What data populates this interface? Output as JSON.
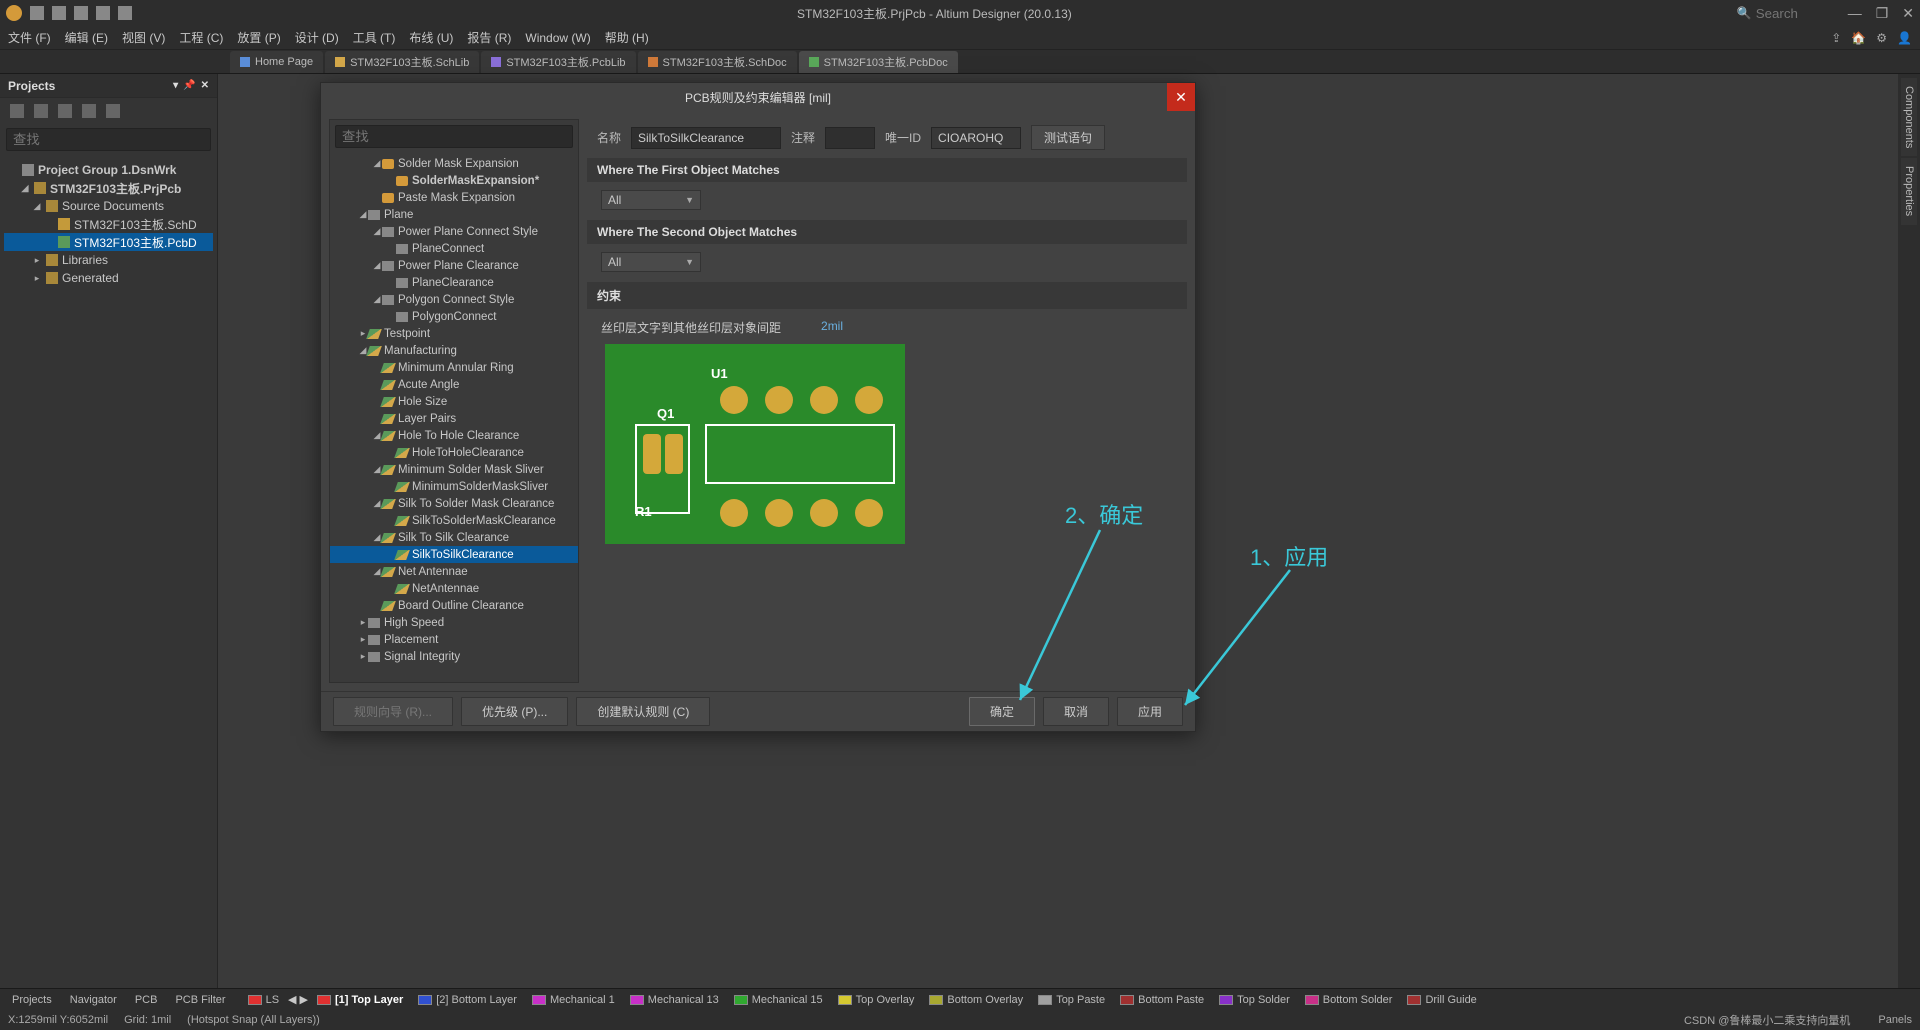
{
  "titlebar": {
    "title": "STM32F103主板.PrjPcb - Altium Designer (20.0.13)",
    "search_placeholder": "Search"
  },
  "menubar": {
    "items": [
      "文件 (F)",
      "编辑 (E)",
      "视图 (V)",
      "工程 (C)",
      "放置 (P)",
      "设计 (D)",
      "工具 (T)",
      "布线 (U)",
      "报告 (R)",
      "Window (W)",
      "帮助 (H)"
    ]
  },
  "doc_tabs": [
    {
      "label": "Home Page",
      "cls": "ico-home"
    },
    {
      "label": "STM32F103主板.SchLib",
      "cls": "ico-sch"
    },
    {
      "label": "STM32F103主板.PcbLib",
      "cls": "ico-pcblib"
    },
    {
      "label": "STM32F103主板.SchDoc",
      "cls": "ico-schdoc"
    },
    {
      "label": "STM32F103主板.PcbDoc",
      "cls": "ico-pcbdoc",
      "active": true
    }
  ],
  "projects_panel": {
    "title": "Projects",
    "search_placeholder": "查找",
    "tree": [
      {
        "ind": 0,
        "arrow": "",
        "ico": "grp",
        "label": "Project Group 1.DsnWrk",
        "bold": true,
        "sel": false
      },
      {
        "ind": 1,
        "arrow": "◢",
        "ico": "fld",
        "label": "STM32F103主板.PrjPcb",
        "bold": true,
        "sel": false
      },
      {
        "ind": 2,
        "arrow": "◢",
        "ico": "fld",
        "label": "Source Documents",
        "bold": false,
        "sel": false
      },
      {
        "ind": 3,
        "arrow": "",
        "ico": "sch",
        "label": "STM32F103主板.SchD",
        "bold": false,
        "sel": false
      },
      {
        "ind": 3,
        "arrow": "",
        "ico": "pcb",
        "label": "STM32F103主板.PcbD",
        "bold": false,
        "sel": true
      },
      {
        "ind": 2,
        "arrow": "▸",
        "ico": "fld",
        "label": "Libraries",
        "bold": false,
        "sel": false
      },
      {
        "ind": 2,
        "arrow": "▸",
        "ico": "fld",
        "label": "Generated",
        "bold": false,
        "sel": false
      }
    ]
  },
  "right_strip": {
    "tabs": [
      "Components",
      "Properties"
    ]
  },
  "dialog": {
    "title": "PCB规则及约束编辑器 [mil]",
    "search_placeholder": "查找",
    "rules_tree": [
      {
        "ind": 3,
        "arrow": "◢",
        "ico": "rt-sub",
        "label": "Solder Mask Expansion"
      },
      {
        "ind": 4,
        "arrow": "",
        "ico": "rt-sub",
        "label": "SolderMaskExpansion*",
        "bold": true
      },
      {
        "ind": 3,
        "arrow": "",
        "ico": "rt-sub",
        "label": "Paste Mask Expansion"
      },
      {
        "ind": 2,
        "arrow": "◢",
        "ico": "rt-gray",
        "label": "Plane"
      },
      {
        "ind": 3,
        "arrow": "◢",
        "ico": "rt-gray",
        "label": "Power Plane Connect Style"
      },
      {
        "ind": 4,
        "arrow": "",
        "ico": "rt-gray",
        "label": "PlaneConnect"
      },
      {
        "ind": 3,
        "arrow": "◢",
        "ico": "rt-gray",
        "label": "Power Plane Clearance"
      },
      {
        "ind": 4,
        "arrow": "",
        "ico": "rt-gray",
        "label": "PlaneClearance"
      },
      {
        "ind": 3,
        "arrow": "◢",
        "ico": "rt-gray",
        "label": "Polygon Connect Style"
      },
      {
        "ind": 4,
        "arrow": "",
        "ico": "rt-gray",
        "label": "PolygonConnect"
      },
      {
        "ind": 2,
        "arrow": "▸",
        "ico": "rt-flag",
        "label": "Testpoint"
      },
      {
        "ind": 2,
        "arrow": "◢",
        "ico": "rt-flag",
        "label": "Manufacturing"
      },
      {
        "ind": 3,
        "arrow": "",
        "ico": "rt-flag",
        "label": "Minimum Annular Ring"
      },
      {
        "ind": 3,
        "arrow": "",
        "ico": "rt-flag",
        "label": "Acute Angle"
      },
      {
        "ind": 3,
        "arrow": "",
        "ico": "rt-flag",
        "label": "Hole Size"
      },
      {
        "ind": 3,
        "arrow": "",
        "ico": "rt-flag",
        "label": "Layer Pairs"
      },
      {
        "ind": 3,
        "arrow": "◢",
        "ico": "rt-flag",
        "label": "Hole To Hole Clearance"
      },
      {
        "ind": 4,
        "arrow": "",
        "ico": "rt-flag",
        "label": "HoleToHoleClearance"
      },
      {
        "ind": 3,
        "arrow": "◢",
        "ico": "rt-flag",
        "label": "Minimum Solder Mask Sliver"
      },
      {
        "ind": 4,
        "arrow": "",
        "ico": "rt-flag",
        "label": "MinimumSolderMaskSliver"
      },
      {
        "ind": 3,
        "arrow": "◢",
        "ico": "rt-flag",
        "label": "Silk To Solder Mask Clearance"
      },
      {
        "ind": 4,
        "arrow": "",
        "ico": "rt-flag",
        "label": "SilkToSolderMaskClearance"
      },
      {
        "ind": 3,
        "arrow": "◢",
        "ico": "rt-flag",
        "label": "Silk To Silk Clearance"
      },
      {
        "ind": 4,
        "arrow": "",
        "ico": "rt-flag",
        "label": "SilkToSilkClearance",
        "sel": true
      },
      {
        "ind": 3,
        "arrow": "◢",
        "ico": "rt-flag",
        "label": "Net Antennae"
      },
      {
        "ind": 4,
        "arrow": "",
        "ico": "rt-flag",
        "label": "NetAntennae"
      },
      {
        "ind": 3,
        "arrow": "",
        "ico": "rt-flag",
        "label": "Board Outline Clearance"
      },
      {
        "ind": 2,
        "arrow": "▸",
        "ico": "rt-gray",
        "label": "High Speed"
      },
      {
        "ind": 2,
        "arrow": "▸",
        "ico": "rt-gray",
        "label": "Placement"
      },
      {
        "ind": 2,
        "arrow": "▸",
        "ico": "rt-gray",
        "label": "Signal Integrity"
      }
    ],
    "props": {
      "name_label": "名称",
      "name_value": "SilkToSilkClearance",
      "comment_label": "注释",
      "comment_value": "",
      "uid_label": "唯一ID",
      "uid_value": "CIOAROHQ",
      "test_btn": "测试语句"
    },
    "sections": {
      "first_match": "Where The First Object Matches",
      "second_match": "Where The Second Object Matches",
      "constraint": "约束",
      "combo_value": "All"
    },
    "constraint": {
      "label": "丝印层文字到其他丝印层对象间距",
      "value": "2mil",
      "u1": "U1",
      "q1": "Q1",
      "r1": "R1"
    },
    "footer": {
      "rule_wizard": "规则向导 (R)...",
      "priority": "优先级 (P)...",
      "create_default": "创建默认规则 (C)",
      "ok": "确定",
      "cancel": "取消",
      "apply": "应用"
    }
  },
  "annotations": {
    "ok": "2、确定",
    "apply": "1、应用"
  },
  "bottom_tabs": {
    "left": [
      "Projects",
      "Navigator",
      "PCB",
      "PCB Filter"
    ],
    "ls": "LS",
    "layers": [
      {
        "color": "#e03030",
        "label": "[1] Top Layer",
        "bold": true
      },
      {
        "color": "#3050d0",
        "label": "[2] Bottom Layer"
      },
      {
        "color": "#c830c8",
        "label": "Mechanical 1"
      },
      {
        "color": "#c830c8",
        "label": "Mechanical 13"
      },
      {
        "color": "#30a830",
        "label": "Mechanical 15"
      },
      {
        "color": "#d4c830",
        "label": "Top Overlay"
      },
      {
        "color": "#a8a830",
        "label": "Bottom Overlay"
      },
      {
        "color": "#a0a0a0",
        "label": "Top Paste"
      },
      {
        "color": "#a03030",
        "label": "Bottom Paste"
      },
      {
        "color": "#8830c8",
        "label": "Top Solder"
      },
      {
        "color": "#c83088",
        "label": "Bottom Solder"
      },
      {
        "color": "#a03030",
        "label": "Drill Guide"
      }
    ]
  },
  "statusbar": {
    "coords": "X:1259mil Y:6052mil",
    "grid": "Grid: 1mil",
    "snap": "(Hotspot Snap (All Layers))",
    "watermark": "CSDN @鲁棒最小二乘支持向量机",
    "panels": "Panels"
  }
}
